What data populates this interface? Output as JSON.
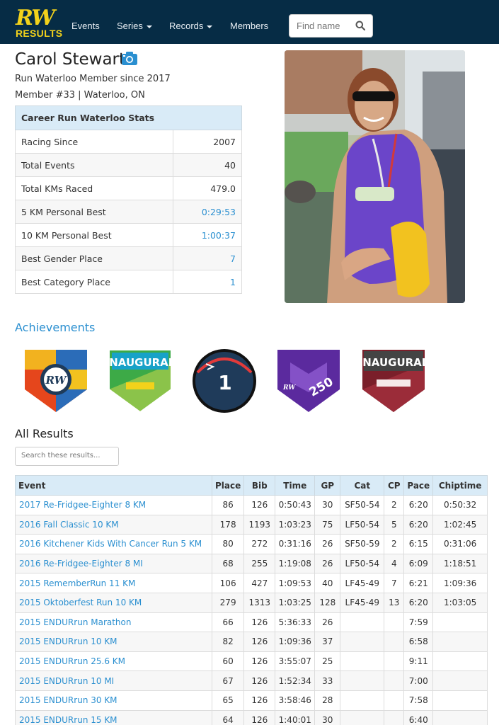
{
  "brand": {
    "logo_text": "RW",
    "logo_sub": "RESULTS",
    "logo_color": "#f2d21b"
  },
  "nav": {
    "events": "Events",
    "series": "Series",
    "records": "Records",
    "members": "Members",
    "search_placeholder": "Find name"
  },
  "profile": {
    "name": "Carol Stewart",
    "member_since": "Run Waterloo Member since 2017",
    "member_info": "Member #33 | Waterloo, ON"
  },
  "stats": {
    "header": "Career Run Waterloo Stats",
    "rows": [
      {
        "label": "Racing Since",
        "value": "2007",
        "link": false
      },
      {
        "label": "Total Events",
        "value": "40",
        "link": false
      },
      {
        "label": "Total KMs Raced",
        "value": "479.0",
        "link": false
      },
      {
        "label": "5 KM Personal Best",
        "value": "0:29:53",
        "link": true
      },
      {
        "label": "10 KM Personal Best",
        "value": "1:00:37",
        "link": true
      },
      {
        "label": "Best Gender Place",
        "value": "7",
        "link": true
      },
      {
        "label": "Best Category Place",
        "value": "1",
        "link": true
      }
    ]
  },
  "achievements": {
    "title": "Achievements",
    "badges": [
      {
        "icon": "rw-member-badge",
        "text": "RW"
      },
      {
        "icon": "inaugural-badge-green",
        "text": "INAUGURAL"
      },
      {
        "icon": "first-place-badge",
        "text": "1"
      },
      {
        "icon": "250-km-badge",
        "text": "250"
      },
      {
        "icon": "inaugural-badge-maroon",
        "text": "INAUGURAL"
      }
    ]
  },
  "results": {
    "title": "All Results",
    "search_placeholder": "Search these results...",
    "columns": [
      "Event",
      "Place",
      "Bib",
      "Time",
      "GP",
      "Cat",
      "CP",
      "Pace",
      "Chiptime"
    ],
    "rows": [
      {
        "event": "2017 Re-Fridgee-Eighter 8 KM",
        "place": "86",
        "bib": "126",
        "time": "0:50:43",
        "gp": "30",
        "cat": "SF50-54",
        "cp": "2",
        "pace": "6:20",
        "chip": "0:50:32"
      },
      {
        "event": "2016 Fall Classic 10 KM",
        "place": "178",
        "bib": "1193",
        "time": "1:03:23",
        "gp": "75",
        "cat": "LF50-54",
        "cp": "5",
        "pace": "6:20",
        "chip": "1:02:45"
      },
      {
        "event": "2016 Kitchener Kids With Cancer Run 5 KM",
        "place": "80",
        "bib": "272",
        "time": "0:31:16",
        "gp": "26",
        "cat": "SF50-59",
        "cp": "2",
        "pace": "6:15",
        "chip": "0:31:06"
      },
      {
        "event": "2016 Re-Fridgee-Eighter 8 MI",
        "place": "68",
        "bib": "255",
        "time": "1:19:08",
        "gp": "26",
        "cat": "LF50-54",
        "cp": "4",
        "pace": "6:09",
        "chip": "1:18:51"
      },
      {
        "event": "2015 RememberRun 11 KM",
        "place": "106",
        "bib": "427",
        "time": "1:09:53",
        "gp": "40",
        "cat": "LF45-49",
        "cp": "7",
        "pace": "6:21",
        "chip": "1:09:36"
      },
      {
        "event": "2015 Oktoberfest Run 10 KM",
        "place": "279",
        "bib": "1313",
        "time": "1:03:25",
        "gp": "128",
        "cat": "LF45-49",
        "cp": "13",
        "pace": "6:20",
        "chip": "1:03:05"
      },
      {
        "event": "2015 ENDURrun Marathon",
        "place": "66",
        "bib": "126",
        "time": "5:36:33",
        "gp": "26",
        "cat": "",
        "cp": "",
        "pace": "7:59",
        "chip": ""
      },
      {
        "event": "2015 ENDURrun 10 KM",
        "place": "82",
        "bib": "126",
        "time": "1:09:36",
        "gp": "37",
        "cat": "",
        "cp": "",
        "pace": "6:58",
        "chip": ""
      },
      {
        "event": "2015 ENDURrun 25.6 KM",
        "place": "60",
        "bib": "126",
        "time": "3:55:07",
        "gp": "25",
        "cat": "",
        "cp": "",
        "pace": "9:11",
        "chip": ""
      },
      {
        "event": "2015 ENDURrun 10 MI",
        "place": "67",
        "bib": "126",
        "time": "1:52:34",
        "gp": "33",
        "cat": "",
        "cp": "",
        "pace": "7:00",
        "chip": ""
      },
      {
        "event": "2015 ENDURrun 30 KM",
        "place": "65",
        "bib": "126",
        "time": "3:58:46",
        "gp": "28",
        "cat": "",
        "cp": "",
        "pace": "7:58",
        "chip": ""
      },
      {
        "event": "2015 ENDURrun 15 KM",
        "place": "64",
        "bib": "126",
        "time": "1:40:01",
        "gp": "30",
        "cat": "",
        "cp": "",
        "pace": "6:40",
        "chip": ""
      }
    ]
  },
  "colors": {
    "navbar": "#062c45",
    "link": "#2a8fd0",
    "table_header": "#d9ebf7"
  }
}
